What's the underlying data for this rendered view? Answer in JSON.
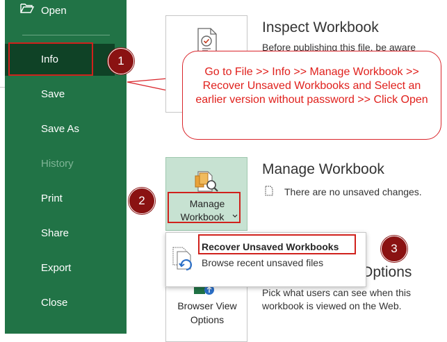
{
  "sidebar": {
    "items": [
      {
        "label": "Open"
      },
      {
        "label": "Info"
      },
      {
        "label": "Save"
      },
      {
        "label": "Save As"
      },
      {
        "label": "History"
      },
      {
        "label": "Print"
      },
      {
        "label": "Share"
      },
      {
        "label": "Export"
      },
      {
        "label": "Close"
      }
    ]
  },
  "inspect": {
    "title": "Inspect Workbook",
    "description": "Before publishing this file, be aware"
  },
  "manage": {
    "title": "Manage Workbook",
    "button_line1": "Manage",
    "button_line2": "Workbook",
    "status": "There are no unsaved changes."
  },
  "dropdown": {
    "item_title": "Recover Unsaved Workbooks",
    "item_desc": "Browse recent unsaved files"
  },
  "browser_view": {
    "title_partial": "Options",
    "button_line1": "Browser View",
    "button_line2": "Options",
    "desc_line1": "Pick what users can see when this",
    "desc_line2": "workbook is viewed on the Web."
  },
  "callout": {
    "text": "Go to File >> Info >> Manage Workbook >> Recover Unsaved Workbooks and Select an earlier version without password >> Click Open"
  },
  "badges": [
    "1",
    "2",
    "3"
  ],
  "colors": {
    "sidebar": "#217346",
    "sidebar_active": "#0f4226",
    "annotation_red": "#d0211c",
    "badge": "#8a1212",
    "selected_card": "#c7e2d2"
  }
}
